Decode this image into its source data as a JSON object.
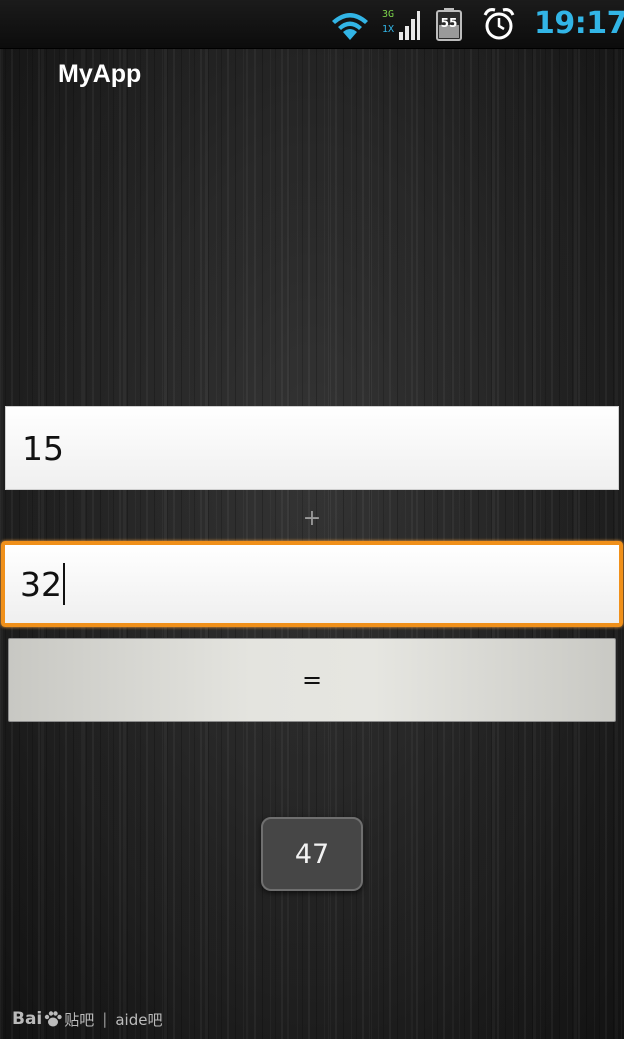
{
  "status_bar": {
    "time": "19:17",
    "network_type": "3G",
    "network_sub": "1X",
    "battery_level": "55",
    "icons": [
      "wifi-icon",
      "signal-icon",
      "battery-icon",
      "alarm-icon"
    ],
    "clock_color": "#32b5e6"
  },
  "app": {
    "title": "MyApp"
  },
  "calculator": {
    "first_value": "15",
    "operator": "+",
    "second_value": "32",
    "equals_label": "=",
    "result_toast": "47"
  },
  "colors": {
    "focus_border": "#f0901a",
    "toast_bg": "#464646"
  },
  "watermark": {
    "brand_left": "Bai",
    "brand_right": "贴吧",
    "separator": "|",
    "forum": "aide吧"
  }
}
